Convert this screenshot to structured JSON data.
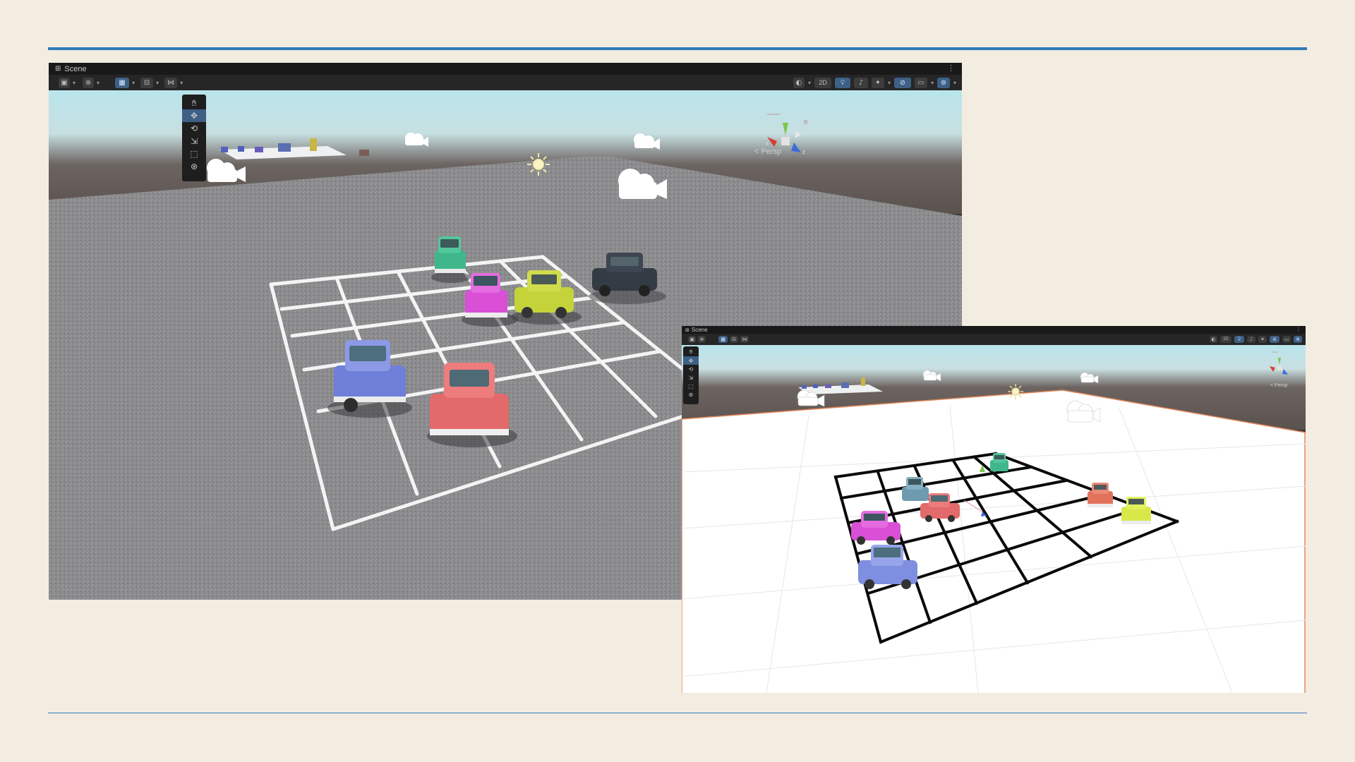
{
  "main_window": {
    "title": "Scene",
    "toolbar": {
      "left": [
        "draw-mode",
        "global",
        "grid-snapping",
        "snap-increment",
        "incremental-snap"
      ],
      "right": [
        "shading-mode",
        "2D",
        "lighting",
        "audio",
        "effects",
        "hidden-objects",
        "camera",
        "gizmos"
      ],
      "toggle_2d_label": "2D"
    },
    "tools": [
      "hand",
      "move",
      "rotate",
      "scale",
      "rect",
      "transform"
    ],
    "active_tool": "move",
    "gizmo_label": "< Persp",
    "ground": "asphalt",
    "grid_lines": "white",
    "cars": [
      {
        "color": "#3fb78a"
      },
      {
        "color": "#d94fd6"
      },
      {
        "color": "#c5d33a"
      },
      {
        "color": "#333b45"
      },
      {
        "color": "#6f7fd8"
      },
      {
        "color": "#e36a6a"
      }
    ]
  },
  "overlay_window": {
    "title": "Scene",
    "toolbar": {
      "toggle_2d_label": "2D"
    },
    "gizmo_label": "< Persp",
    "ground": "white",
    "grid_lines": "black",
    "cars": [
      {
        "color": "#3fb78a"
      },
      {
        "color": "#6f9bb0"
      },
      {
        "color": "#e36a6a"
      },
      {
        "color": "#d94fd6"
      },
      {
        "color": "#7e8fe0"
      },
      {
        "color": "#e2725c"
      },
      {
        "color": "#d8e84a"
      }
    ]
  },
  "colors": {
    "accent_rule": "#2f7ab8",
    "page_bg": "#f2ece1",
    "active_tool": "#3e5f86",
    "sky": "#b4dfe6",
    "horizon": "#5d5450",
    "asphalt": "#8a8a8c"
  }
}
